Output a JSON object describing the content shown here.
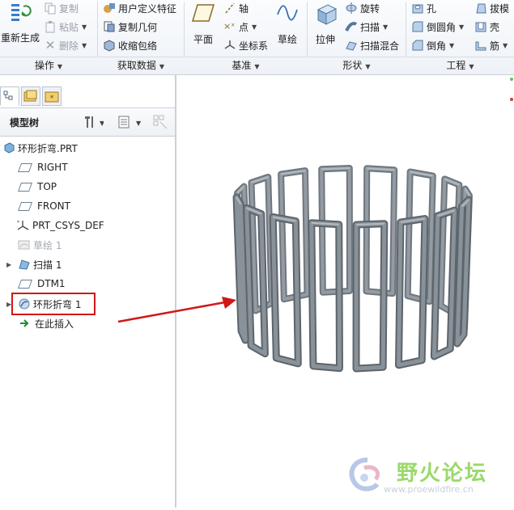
{
  "ribbon": {
    "regenerate": {
      "label": "重新生成"
    },
    "edit_ops": [
      {
        "label": "复制",
        "enabled": false
      },
      {
        "label": "粘贴",
        "enabled": false
      },
      {
        "label": "删除",
        "enabled": false
      }
    ],
    "get_data": [
      {
        "label": "用户定义特征"
      },
      {
        "label": "复制几何"
      },
      {
        "label": "收缩包络"
      }
    ],
    "datum": {
      "plane": "平面",
      "axis": "轴",
      "point": "点",
      "csys": "坐标系",
      "sketch": "草绘"
    },
    "shapes": {
      "extrude": "拉伸",
      "revolve": "旋转",
      "sweep": "扫描",
      "swept_blend": "扫描混合"
    },
    "engineering": {
      "hole": "孔",
      "round": "倒圆角",
      "chamfer": "倒角",
      "draft": "拔模",
      "shell": "壳",
      "rib": "筋"
    },
    "groups": {
      "operations": "操作",
      "get_data": "获取数据",
      "datum": "基准",
      "shapes": "形状",
      "engineering": "工程"
    }
  },
  "model_tree": {
    "title": "模型树",
    "items": [
      {
        "label": "环形折弯.PRT",
        "icon": "part-icon"
      },
      {
        "label": "RIGHT",
        "icon": "datum-plane-icon"
      },
      {
        "label": "TOP",
        "icon": "datum-plane-icon"
      },
      {
        "label": "FRONT",
        "icon": "datum-plane-icon"
      },
      {
        "label": "PRT_CSYS_DEF",
        "icon": "csys-icon"
      },
      {
        "label": "草绘 1",
        "icon": "sketch-icon",
        "suppressed": true
      },
      {
        "label": "扫描 1",
        "icon": "sweep-icon",
        "expandable": true
      },
      {
        "label": "DTM1",
        "icon": "datum-plane-icon"
      },
      {
        "label": "环形折弯 1",
        "icon": "toroidal-bend-icon",
        "expandable": true,
        "highlighted": true
      },
      {
        "label": "在此插入",
        "icon": "insert-here-icon"
      }
    ]
  },
  "watermark": {
    "title": "野火论坛",
    "url": "www.proewildfire.cn"
  },
  "colors": {
    "annotation_red": "#d01818",
    "model_gray": "#7d858d",
    "watermark_green": "#9ad96a"
  }
}
